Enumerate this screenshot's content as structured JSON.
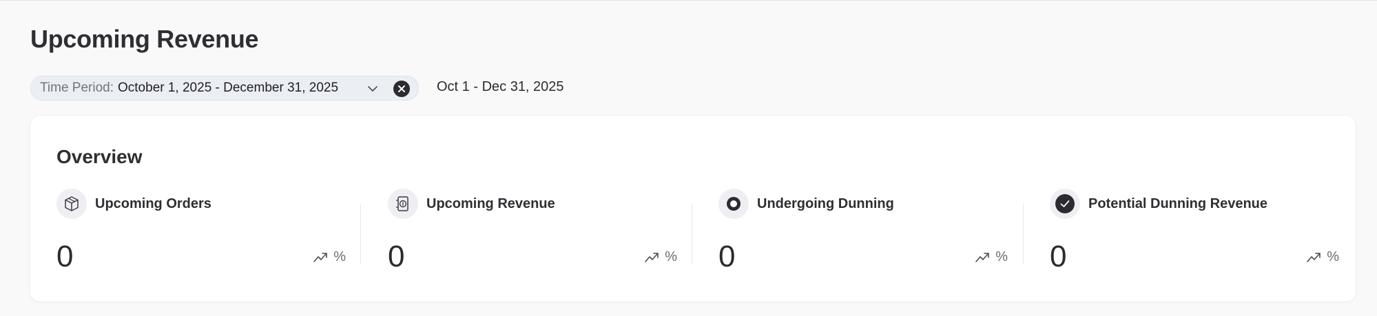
{
  "page": {
    "title": "Upcoming Revenue"
  },
  "filter": {
    "label": "Time Period:",
    "value": "October 1, 2025 - December 31, 2025",
    "summary": "Oct 1 - Dec 31, 2025"
  },
  "overview": {
    "title": "Overview",
    "metrics": [
      {
        "label": "Upcoming Orders",
        "value": "0",
        "trend_unit": "%",
        "icon": "box-icon"
      },
      {
        "label": "Upcoming Revenue",
        "value": "0",
        "trend_unit": "%",
        "icon": "revenue-icon"
      },
      {
        "label": "Undergoing Dunning",
        "value": "0",
        "trend_unit": "%",
        "icon": "ring-icon"
      },
      {
        "label": "Potential Dunning Revenue",
        "value": "0",
        "trend_unit": "%",
        "icon": "check-circle-icon"
      }
    ]
  },
  "colors": {
    "background": "#f9f9fa",
    "card": "#ffffff",
    "chip": "#ebeef3",
    "text": "#2b2b2e",
    "muted": "#6f7480"
  }
}
